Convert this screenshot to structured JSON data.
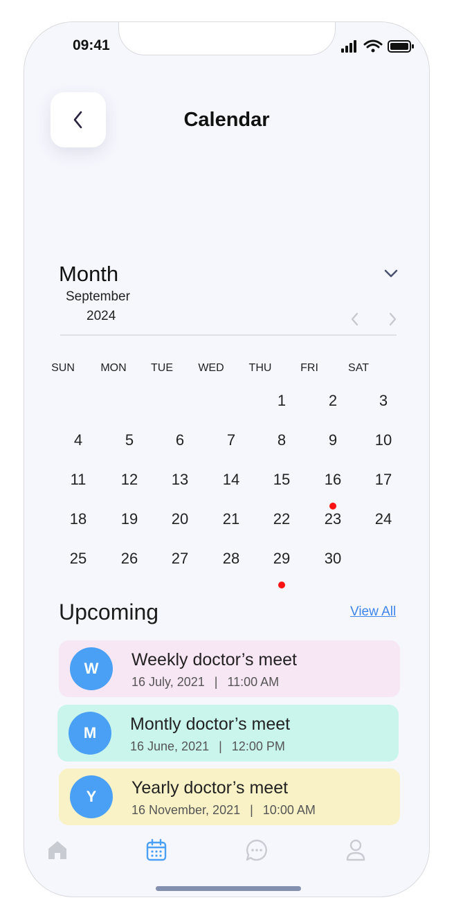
{
  "status_bar": {
    "time": "09:41"
  },
  "header": {
    "title": "Calendar"
  },
  "calendar": {
    "mode_label": "Month",
    "month": "September",
    "year": "2024",
    "weekdays": [
      "SUN",
      "MON",
      "TUE",
      "WED",
      "THU",
      "FRI",
      "SAT"
    ],
    "days": [
      "1",
      "2",
      "3",
      "4",
      "5",
      "6",
      "7",
      "8",
      "9",
      "10",
      "11",
      "12",
      "13",
      "14",
      "15",
      "16",
      "17",
      "18",
      "19",
      "20",
      "21",
      "22",
      "23",
      "24",
      "25",
      "26",
      "27",
      "28",
      "29",
      "30"
    ],
    "first_weekday_index": 4,
    "event_days": [
      "16",
      "29"
    ],
    "event_dot_color": "#ff1212"
  },
  "upcoming": {
    "title": "Upcoming",
    "view_all_label": "View All",
    "events": [
      {
        "initial": "W",
        "title": "Weekly doctor’s meet",
        "date": "16 July, 2021",
        "separator": "|",
        "time": "11:00 AM",
        "color": "#f7e6f4"
      },
      {
        "initial": "M",
        "title": "Montly doctor’s meet",
        "date": "16 June, 2021",
        "separator": "|",
        "time": "12:00 PM",
        "color": "#c9f5ec"
      },
      {
        "initial": "Y",
        "title": "Yearly doctor’s meet",
        "date": "16 November, 2021",
        "separator": "|",
        "time": "10:00 AM",
        "color": "#f8f2c6"
      }
    ]
  },
  "bottom_nav": {
    "items": [
      {
        "icon": "home-icon",
        "active": false
      },
      {
        "icon": "calendar-icon",
        "active": true
      },
      {
        "icon": "chat-icon",
        "active": false
      },
      {
        "icon": "profile-icon",
        "active": false
      }
    ],
    "active_color": "#4aa0f5",
    "inactive_color": "#c9cbd3"
  }
}
